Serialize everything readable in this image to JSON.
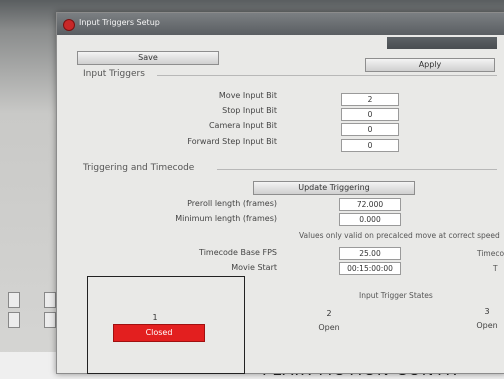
{
  "window": {
    "title": "Input Triggers Setup",
    "save_label": "Save",
    "apply_label": "Apply"
  },
  "input_triggers": {
    "section_title": "Input Triggers",
    "rows": [
      {
        "label": "Move Input Bit",
        "value": "2"
      },
      {
        "label": "Stop Input Bit",
        "value": "0"
      },
      {
        "label": "Camera Input Bit",
        "value": "0"
      },
      {
        "label": "Forward Step Input Bit",
        "value": "0"
      }
    ]
  },
  "triggering": {
    "section_title": "Triggering and Timecode",
    "update_label": "Update Triggering",
    "preroll_label": "Preroll length (frames)",
    "preroll_value": "72.000",
    "minlen_label": "Minimum length (frames)",
    "minlen_value": "0.000",
    "note": "Values only valid on precalced move at correct speed",
    "tc_fps_label": "Timecode Base FPS",
    "tc_fps_value": "25.00",
    "movie_start_label": "Movie Start",
    "movie_start_value": "00:15:00:00",
    "right_cut_1": "Timeco",
    "right_cut_2": "T"
  },
  "states": {
    "title": "Input Trigger States",
    "items": [
      {
        "num": "1",
        "text": "Closed"
      },
      {
        "num": "2",
        "text": "Open"
      },
      {
        "num": "3",
        "text": "Open"
      }
    ]
  },
  "background": {
    "bottom_text": "FLAIR MOTION CONTR"
  },
  "colors": {
    "closed": "#e31f1f",
    "titlebar": "#5a5e62"
  }
}
